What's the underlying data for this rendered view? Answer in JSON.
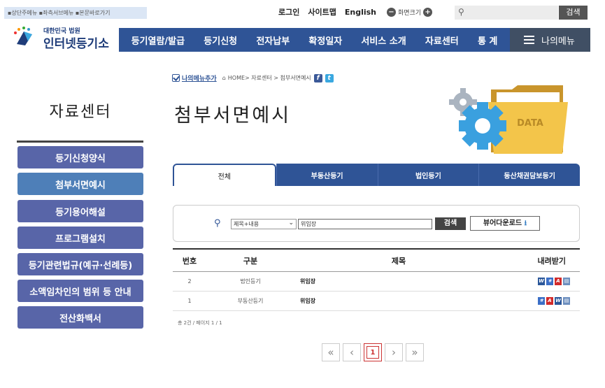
{
  "skip_links": "▪상단주메뉴 ▪좌측서브메뉴 ▪본문바로가기",
  "util": {
    "login": "로그인",
    "sitemap": "사이트맵",
    "english": "English",
    "font_size": "화면크기"
  },
  "top_search": {
    "button": "검색",
    "placeholder": ""
  },
  "logo": {
    "sub": "대한민국 법원",
    "main": "인터넷등기소"
  },
  "gnb": [
    "등기열람/발급",
    "등기신청",
    "전자납부",
    "확정일자",
    "서비스 소개",
    "자료센터",
    "통 계"
  ],
  "my_menu": "나의메뉴",
  "sidebar": {
    "title": "자료센터",
    "items": [
      "등기신청양식",
      "첨부서면예시",
      "등기용어해설",
      "프로그램설치",
      "등기관련법규(예규·선례등)",
      "소액임차인의 범위 등 안내",
      "전산화백서"
    ],
    "active_index": 1
  },
  "breadcrumb": {
    "add_menu": "나의메뉴추가",
    "path": "HOME> 자료센터 > 첨부서면예시"
  },
  "page_title": "첨부서면예시",
  "deco_label": "DATA",
  "tabs": [
    "전체",
    "부동산등기",
    "법인등기",
    "동산채권담보등기"
  ],
  "active_tab": 0,
  "search": {
    "select_value": "제목+내용",
    "keyword": "위임장",
    "button": "검색",
    "viewer_button": "뷰어다운로드"
  },
  "table": {
    "headers": [
      "번호",
      "구분",
      "제목",
      "내려받기"
    ],
    "rows": [
      {
        "no": "2",
        "category": "법인등기",
        "title": "위임장",
        "files": [
          "doc-icon",
          "hwp-icon",
          "pdf-icon",
          "img-icon"
        ]
      },
      {
        "no": "1",
        "category": "부동산등기",
        "title": "위임장",
        "files": [
          "hwp-icon",
          "pdf-icon",
          "doc-icon",
          "img-icon"
        ]
      }
    ]
  },
  "total": "총 2건 / 페이지 1 / 1",
  "paging": {
    "first": "«",
    "prev": "‹",
    "current": "1",
    "next": "›",
    "last": "»"
  },
  "colors": {
    "primary": "#2f5496",
    "sidebar": "#5865a8",
    "sidebar_active": "#4e7fb8"
  }
}
